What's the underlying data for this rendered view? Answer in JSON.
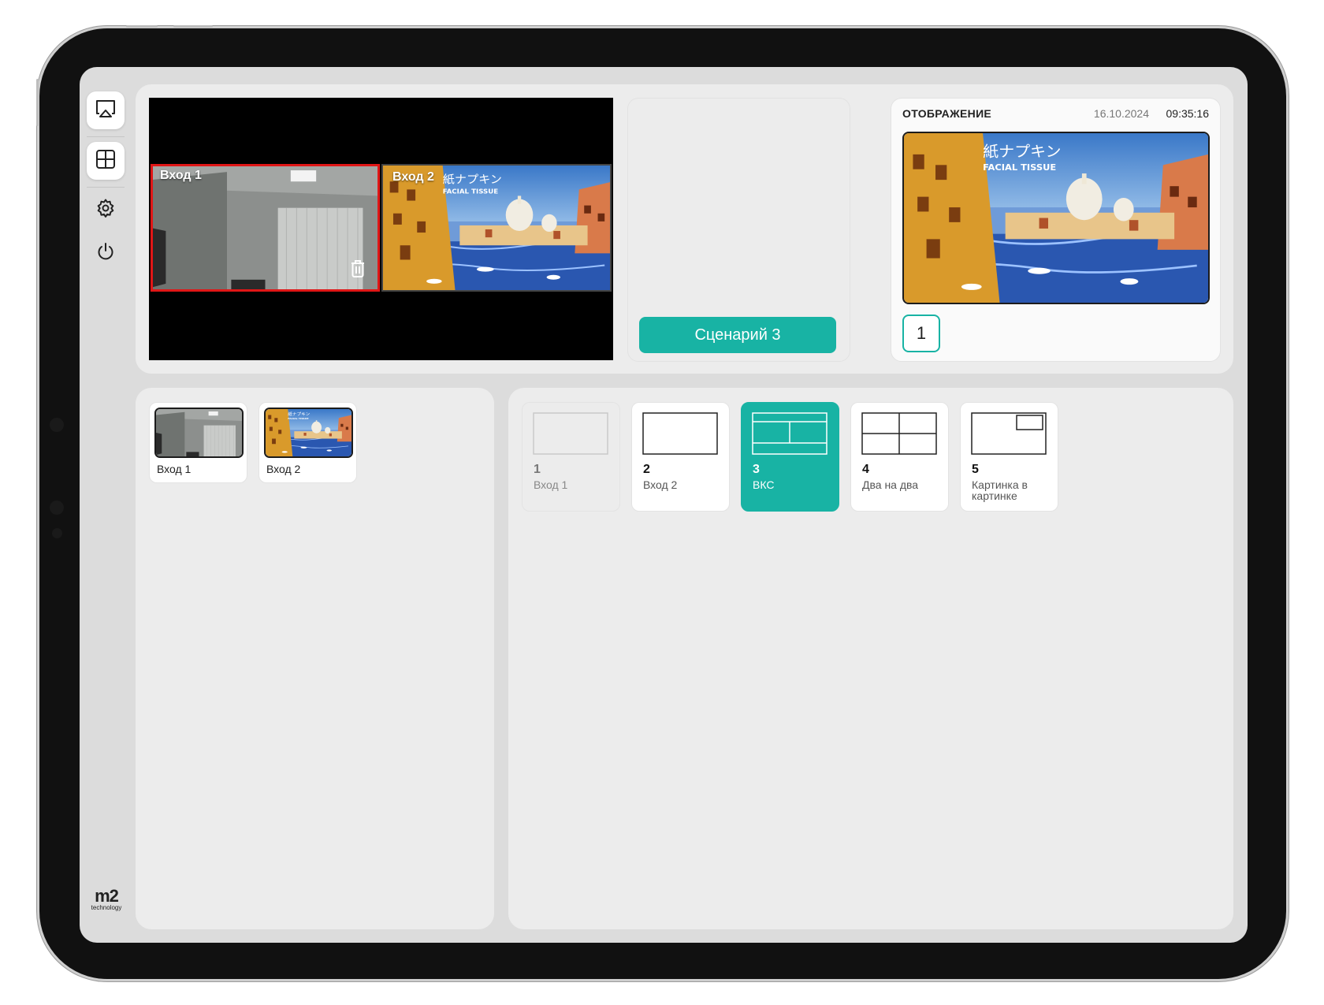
{
  "sidebar": {
    "items": [
      {
        "icon": "airplay-icon"
      },
      {
        "icon": "grid-icon"
      },
      {
        "icon": "gear-icon"
      },
      {
        "icon": "power-icon"
      }
    ],
    "logo": {
      "mark": "m2",
      "sub": "technology"
    }
  },
  "preview": {
    "cells": [
      {
        "label": "Вход 1",
        "selected": true
      },
      {
        "label": "Вход 2",
        "selected": false
      }
    ],
    "selection_color": "#e01616"
  },
  "scenario": {
    "button_label": "Сценарий 3"
  },
  "display": {
    "title": "ОТОБРАЖЕНИЕ",
    "date": "16.10.2024",
    "time": "09:35:16",
    "selected_number": "1"
  },
  "sources": [
    {
      "label": "Вход 1"
    },
    {
      "label": "Вход 2"
    }
  ],
  "layouts": [
    {
      "num": "1",
      "name": "Вход 1",
      "state": "disabled"
    },
    {
      "num": "2",
      "name": "Вход 2",
      "state": "normal"
    },
    {
      "num": "3",
      "name": "ВКС",
      "state": "active"
    },
    {
      "num": "4",
      "name": "Два на два",
      "state": "normal"
    },
    {
      "num": "5",
      "name": "Картинка в картинке",
      "state": "normal"
    }
  ],
  "colors": {
    "accent": "#18b3a4",
    "selection": "#e01616"
  }
}
